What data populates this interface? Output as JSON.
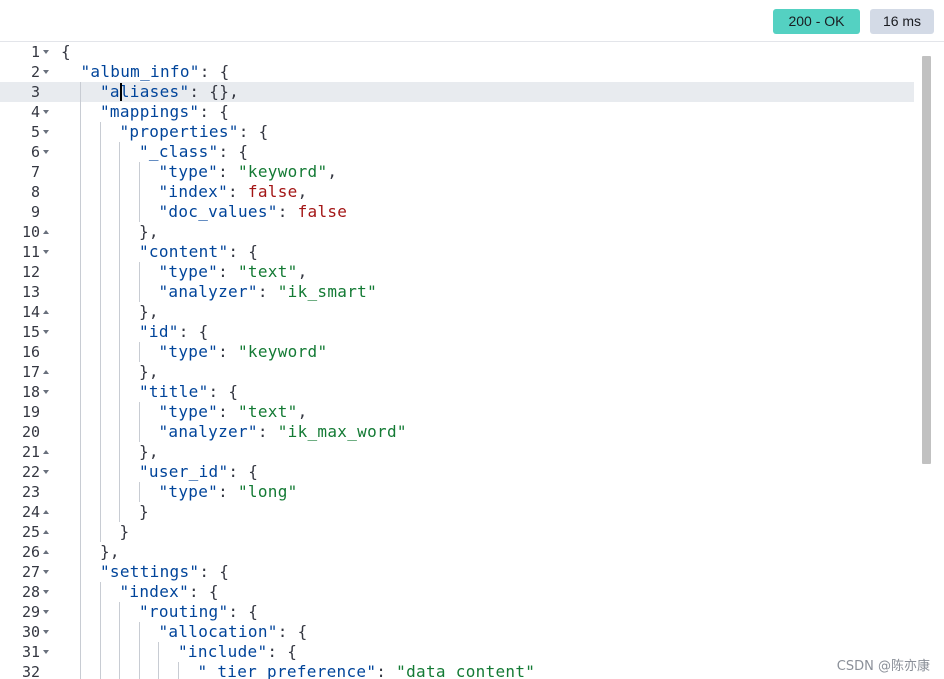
{
  "response": {
    "status_label": "200 - OK",
    "time_label": "16 ms"
  },
  "editor": {
    "active_line": 3,
    "lines": [
      {
        "n": "1",
        "fold": "down",
        "indent": 0,
        "tokens": [
          [
            "p",
            "{"
          ]
        ]
      },
      {
        "n": "2",
        "fold": "down",
        "indent": 1,
        "tokens": [
          [
            "k",
            "\"album_info\""
          ],
          [
            "p",
            ": {"
          ]
        ]
      },
      {
        "n": "3",
        "fold": "",
        "indent": 2,
        "tokens": [
          [
            "k",
            "\"aliases\""
          ],
          [
            "p",
            ": {},"
          ]
        ]
      },
      {
        "n": "4",
        "fold": "down",
        "indent": 2,
        "tokens": [
          [
            "k",
            "\"mappings\""
          ],
          [
            "p",
            ": {"
          ]
        ]
      },
      {
        "n": "5",
        "fold": "down",
        "indent": 3,
        "tokens": [
          [
            "k",
            "\"properties\""
          ],
          [
            "p",
            ": {"
          ]
        ]
      },
      {
        "n": "6",
        "fold": "down",
        "indent": 4,
        "tokens": [
          [
            "k",
            "\"_class\""
          ],
          [
            "p",
            ": {"
          ]
        ]
      },
      {
        "n": "7",
        "fold": "",
        "indent": 5,
        "tokens": [
          [
            "k",
            "\"type\""
          ],
          [
            "p",
            ": "
          ],
          [
            "s",
            "\"keyword\""
          ],
          [
            "p",
            ","
          ]
        ]
      },
      {
        "n": "8",
        "fold": "",
        "indent": 5,
        "tokens": [
          [
            "k",
            "\"index\""
          ],
          [
            "p",
            ": "
          ],
          [
            "b",
            "false"
          ],
          [
            "p",
            ","
          ]
        ]
      },
      {
        "n": "9",
        "fold": "",
        "indent": 5,
        "tokens": [
          [
            "k",
            "\"doc_values\""
          ],
          [
            "p",
            ": "
          ],
          [
            "b",
            "false"
          ]
        ]
      },
      {
        "n": "10",
        "fold": "up",
        "indent": 4,
        "tokens": [
          [
            "p",
            "},"
          ]
        ]
      },
      {
        "n": "11",
        "fold": "down",
        "indent": 4,
        "tokens": [
          [
            "k",
            "\"content\""
          ],
          [
            "p",
            ": {"
          ]
        ]
      },
      {
        "n": "12",
        "fold": "",
        "indent": 5,
        "tokens": [
          [
            "k",
            "\"type\""
          ],
          [
            "p",
            ": "
          ],
          [
            "s",
            "\"text\""
          ],
          [
            "p",
            ","
          ]
        ]
      },
      {
        "n": "13",
        "fold": "",
        "indent": 5,
        "tokens": [
          [
            "k",
            "\"analyzer\""
          ],
          [
            "p",
            ": "
          ],
          [
            "s",
            "\"ik_smart\""
          ]
        ]
      },
      {
        "n": "14",
        "fold": "up",
        "indent": 4,
        "tokens": [
          [
            "p",
            "},"
          ]
        ]
      },
      {
        "n": "15",
        "fold": "down",
        "indent": 4,
        "tokens": [
          [
            "k",
            "\"id\""
          ],
          [
            "p",
            ": {"
          ]
        ]
      },
      {
        "n": "16",
        "fold": "",
        "indent": 5,
        "tokens": [
          [
            "k",
            "\"type\""
          ],
          [
            "p",
            ": "
          ],
          [
            "s",
            "\"keyword\""
          ]
        ]
      },
      {
        "n": "17",
        "fold": "up",
        "indent": 4,
        "tokens": [
          [
            "p",
            "},"
          ]
        ]
      },
      {
        "n": "18",
        "fold": "down",
        "indent": 4,
        "tokens": [
          [
            "k",
            "\"title\""
          ],
          [
            "p",
            ": {"
          ]
        ]
      },
      {
        "n": "19",
        "fold": "",
        "indent": 5,
        "tokens": [
          [
            "k",
            "\"type\""
          ],
          [
            "p",
            ": "
          ],
          [
            "s",
            "\"text\""
          ],
          [
            "p",
            ","
          ]
        ]
      },
      {
        "n": "20",
        "fold": "",
        "indent": 5,
        "tokens": [
          [
            "k",
            "\"analyzer\""
          ],
          [
            "p",
            ": "
          ],
          [
            "s",
            "\"ik_max_word\""
          ]
        ]
      },
      {
        "n": "21",
        "fold": "up",
        "indent": 4,
        "tokens": [
          [
            "p",
            "},"
          ]
        ]
      },
      {
        "n": "22",
        "fold": "down",
        "indent": 4,
        "tokens": [
          [
            "k",
            "\"user_id\""
          ],
          [
            "p",
            ": {"
          ]
        ]
      },
      {
        "n": "23",
        "fold": "",
        "indent": 5,
        "tokens": [
          [
            "k",
            "\"type\""
          ],
          [
            "p",
            ": "
          ],
          [
            "s",
            "\"long\""
          ]
        ]
      },
      {
        "n": "24",
        "fold": "up",
        "indent": 4,
        "tokens": [
          [
            "p",
            "}"
          ]
        ]
      },
      {
        "n": "25",
        "fold": "up",
        "indent": 3,
        "tokens": [
          [
            "p",
            "}"
          ]
        ]
      },
      {
        "n": "26",
        "fold": "up",
        "indent": 2,
        "tokens": [
          [
            "p",
            "},"
          ]
        ]
      },
      {
        "n": "27",
        "fold": "down",
        "indent": 2,
        "tokens": [
          [
            "k",
            "\"settings\""
          ],
          [
            "p",
            ": {"
          ]
        ]
      },
      {
        "n": "28",
        "fold": "down",
        "indent": 3,
        "tokens": [
          [
            "k",
            "\"index\""
          ],
          [
            "p",
            ": {"
          ]
        ]
      },
      {
        "n": "29",
        "fold": "down",
        "indent": 4,
        "tokens": [
          [
            "k",
            "\"routing\""
          ],
          [
            "p",
            ": {"
          ]
        ]
      },
      {
        "n": "30",
        "fold": "down",
        "indent": 5,
        "tokens": [
          [
            "k",
            "\"allocation\""
          ],
          [
            "p",
            ": {"
          ]
        ]
      },
      {
        "n": "31",
        "fold": "down",
        "indent": 6,
        "tokens": [
          [
            "k",
            "\"include\""
          ],
          [
            "p",
            ": {"
          ]
        ]
      },
      {
        "n": "32",
        "fold": "",
        "indent": 7,
        "tokens": [
          [
            "k",
            "\"_tier_preference\""
          ],
          [
            "p",
            ": "
          ],
          [
            "s",
            "\"data_content\""
          ]
        ]
      }
    ]
  },
  "watermark": "CSDN @陈亦康"
}
